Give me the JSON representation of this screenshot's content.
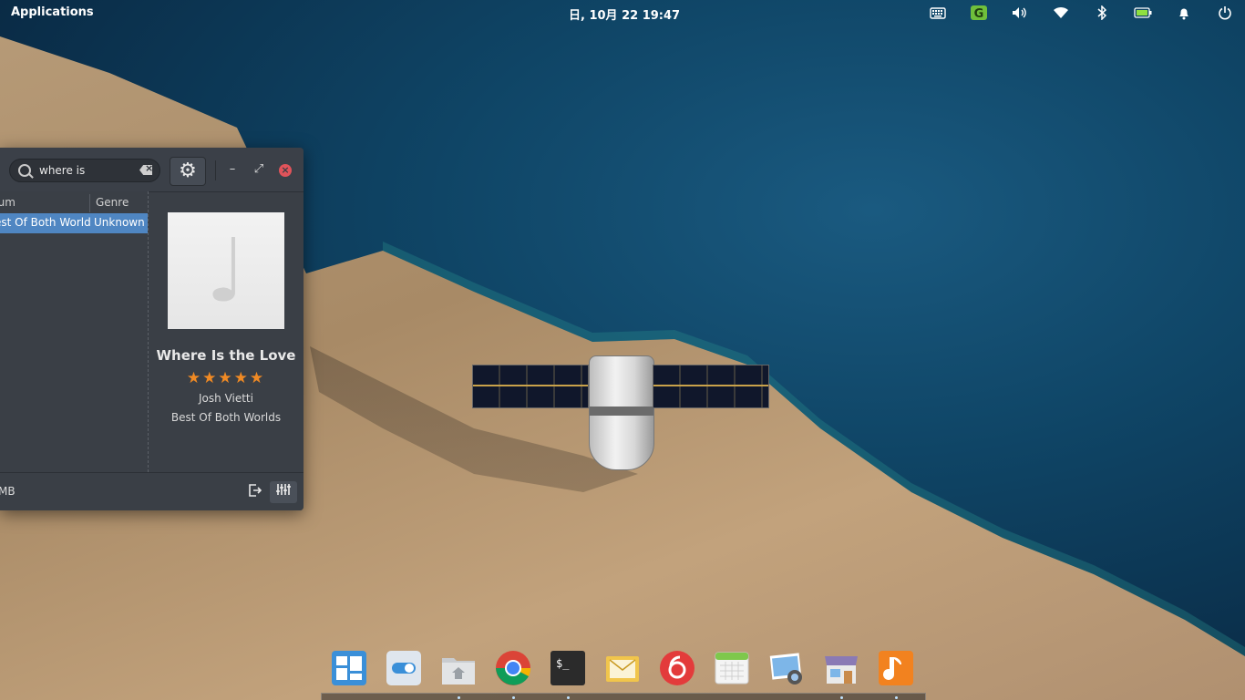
{
  "topbar": {
    "applications_label": "Applications",
    "clock": "日, 10月 22   19:47",
    "indicators": [
      {
        "name": "keyboard-icon",
        "glyph": "⌨"
      },
      {
        "name": "app-indicator-g-icon",
        "glyph": "G"
      },
      {
        "name": "volume-icon",
        "glyph": "🔊"
      },
      {
        "name": "wifi-icon",
        "glyph": "◒"
      },
      {
        "name": "bluetooth-icon",
        "glyph": "✱"
      },
      {
        "name": "battery-icon",
        "glyph": "▭"
      },
      {
        "name": "notifications-bell-icon",
        "glyph": "🔔"
      },
      {
        "name": "power-icon",
        "glyph": "⏻"
      }
    ]
  },
  "music_window": {
    "search": {
      "value": "where is"
    },
    "columns": {
      "album": "bum",
      "genre": "Genre"
    },
    "selected_row": {
      "album": "est Of Both World",
      "genre": "Unknown"
    },
    "now_playing": {
      "title": "Where Is the Love",
      "rating": "★★★★★",
      "artist": "Josh Vietti",
      "album": "Best Of Both Worlds"
    },
    "status": {
      "size_text": "MB"
    },
    "window_controls": {
      "minimize": "–",
      "maximize": "⤢",
      "close": "×"
    }
  },
  "dock": {
    "items": [
      {
        "name": "dock-multitasking-view",
        "color": "#3a8fd8"
      },
      {
        "name": "dock-system-settings",
        "color": "#dfe6ee"
      },
      {
        "name": "dock-files",
        "color": "#d7d9dc"
      },
      {
        "name": "dock-chrome",
        "color": "#ffffff"
      },
      {
        "name": "dock-terminal",
        "color": "#2b2b2b"
      },
      {
        "name": "dock-mail",
        "color": "#f1c54b"
      },
      {
        "name": "dock-netease-music",
        "color": "#e33b3b"
      },
      {
        "name": "dock-calendar",
        "color": "#f4f4f4"
      },
      {
        "name": "dock-photos",
        "color": "#7db6e8"
      },
      {
        "name": "dock-appcenter",
        "color": "#8a7ab5"
      },
      {
        "name": "dock-music",
        "color": "#f2821f"
      }
    ]
  }
}
